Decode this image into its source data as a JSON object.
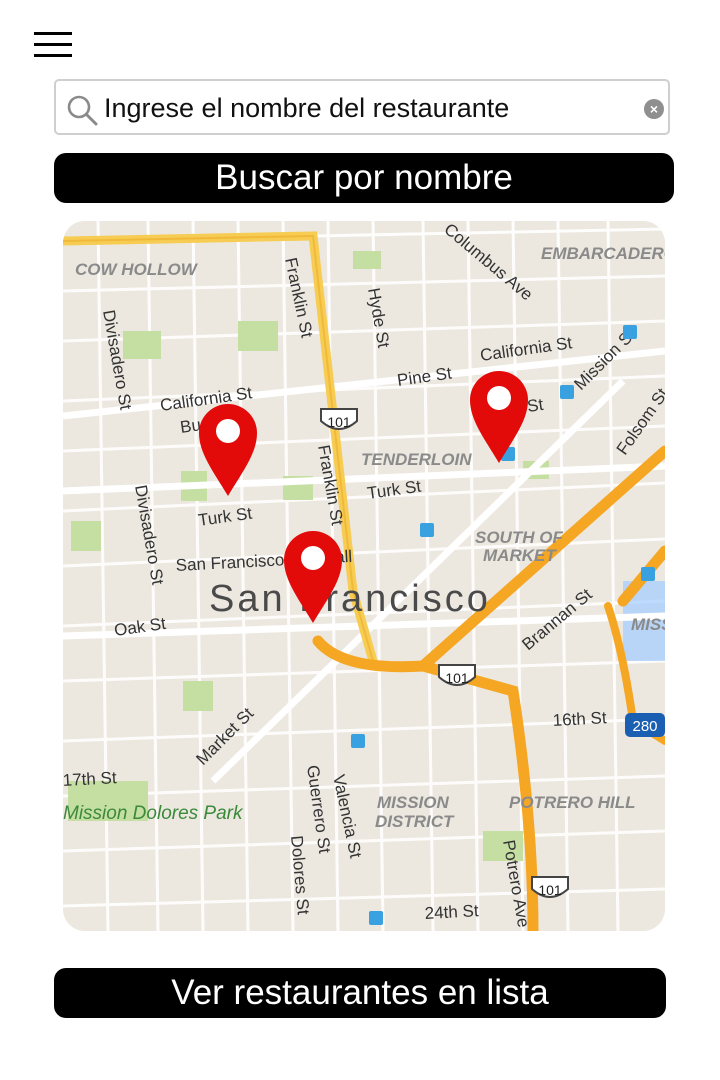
{
  "header": {
    "menu_icon": "hamburger-menu-icon"
  },
  "search": {
    "placeholder": "Ingrese el nombre del restaurante",
    "icon": "search-icon",
    "clear_icon": "clear-icon",
    "clear_glyph": "×"
  },
  "buttons": {
    "search_by_name": "Buscar por nombre",
    "view_list": "Ver restaurantes en lista"
  },
  "map": {
    "city_label": "San Francisco",
    "neighborhoods": [
      "COW HOLLOW",
      "EMBARCADERO",
      "TENDERLOIN",
      "SOUTH OF",
      "MARKET",
      "MISSION",
      "MISSION",
      "DISTRICT",
      "POTRERO HILL"
    ],
    "streets": [
      "Franklin St",
      "Hyde St",
      "Columbus Ave",
      "Divisadero St",
      "California St",
      "California St",
      "Pine St",
      "Mission St",
      "Folsom St",
      "Bush St",
      "Bush St",
      "Turk St",
      "Turk St",
      "Divisadero St",
      "Franklin St",
      "San Francisco City Hall",
      "Oak St",
      "Brannan St",
      "16th St",
      "17th St",
      "Market St",
      "Guerrero St",
      "Valencia St",
      "Dolores St",
      "Potrero Ave",
      "24th St",
      "Mission Dolores Park"
    ],
    "shields": [
      "101",
      "101",
      "101",
      "280"
    ],
    "marker_color": "#e30a0a",
    "marker_count": 3
  },
  "colors": {
    "button_bg": "#000000",
    "button_text": "#ffffff",
    "highway": "#f5a623",
    "highway_secondary": "#f7cc53",
    "park": "#c5dfa3",
    "map_bg": "#ece8e0"
  }
}
